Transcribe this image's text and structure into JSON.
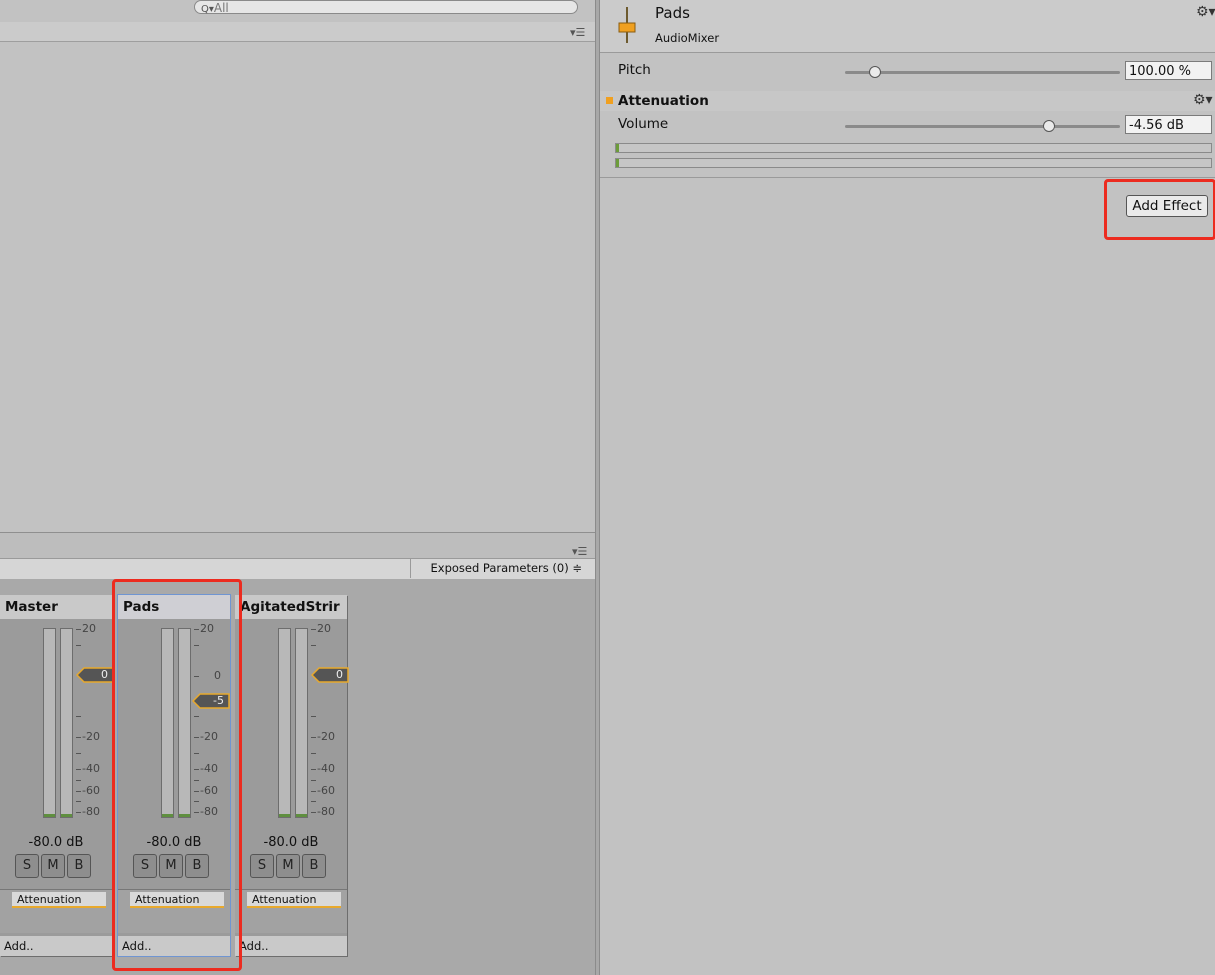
{
  "search": {
    "placeholder": "All"
  },
  "mixer": {
    "exposed_parameters": "Exposed Parameters (0) ≑",
    "strips": [
      {
        "name": "Master",
        "fader_value": "0",
        "db_readout": "-80.0 dB",
        "buttons": [
          "S",
          "M",
          "B"
        ],
        "effect": "Attenuation",
        "add_label": "Add.."
      },
      {
        "name": "Pads",
        "fader_value": "-5",
        "db_readout": "-80.0 dB",
        "buttons": [
          "S",
          "M",
          "B"
        ],
        "effect": "Attenuation",
        "add_label": "Add..",
        "selected": true
      },
      {
        "name": "AgitatedStrir",
        "fader_value": "0",
        "db_readout": "-80.0 dB",
        "buttons": [
          "S",
          "M",
          "B"
        ],
        "effect": "Attenuation",
        "add_label": "Add.."
      }
    ],
    "scale_labels": [
      "20",
      "0",
      "-20",
      "-40",
      "-60",
      "-80"
    ]
  },
  "inspector": {
    "title": "Pads",
    "subtitle": "AudioMixer",
    "pitch": {
      "label": "Pitch",
      "value": "100.00 %",
      "slider_fraction": 0.1
    },
    "attenuation": {
      "title": "Attenuation",
      "volume": {
        "label": "Volume",
        "value": "-4.56 dB",
        "slider_fraction": 0.74
      }
    },
    "add_effect_label": "Add Effect"
  },
  "colors": {
    "accent_orange": "#f0a020",
    "highlight_red": "#ec2b1f",
    "selection_blue": "#6f95d2",
    "meter_green": "#6c9c3a"
  },
  "icons": [
    "search-icon",
    "menu-icon",
    "gear-icon",
    "audio-mixer-icon"
  ]
}
